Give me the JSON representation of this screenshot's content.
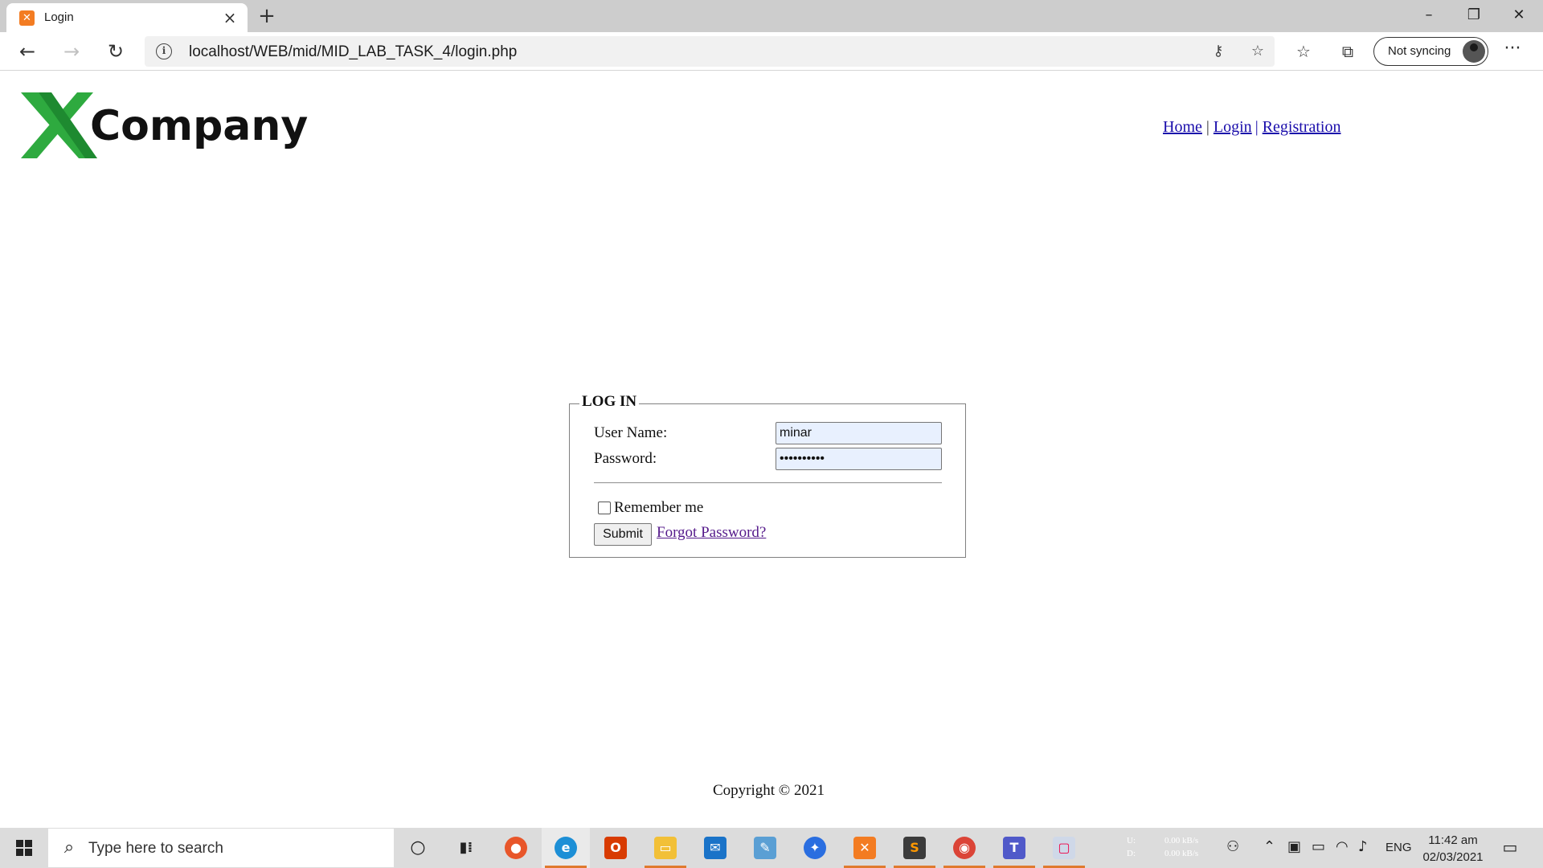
{
  "browser": {
    "tab_title": "Login",
    "url": "localhost/WEB/mid/MID_LAB_TASK_4/login.php",
    "sync_label": "Not syncing"
  },
  "site": {
    "logo_letter": "X",
    "logo_text": "Company",
    "nav": {
      "home": "Home",
      "separator": "|",
      "login": "Login",
      "registration": "Registration"
    }
  },
  "login_form": {
    "legend": "LOG IN",
    "username_label": "User Name:",
    "username_value": "minar",
    "password_label": "Password:",
    "password_value": "••••••••••",
    "remember_label": "Remember me",
    "remember_checked": false,
    "submit_label": "Submit",
    "forgot_label": "Forgot Password?"
  },
  "footer": {
    "copyright": "Copyright © 2021"
  },
  "taskbar": {
    "search_placeholder": "Type here to search",
    "net_up": "0.00 kB/s",
    "net_down": "0.00 kB/s",
    "net_up_label": "U:",
    "net_down_label": "D:",
    "language": "ENG",
    "time": "11:42 am",
    "date": "02/03/2021"
  },
  "colors": {
    "logo_green": "#2eaa3f",
    "link_visited": "#551a8b",
    "link": "#1a0dab",
    "autofill_bg": "#e8f0fe"
  }
}
